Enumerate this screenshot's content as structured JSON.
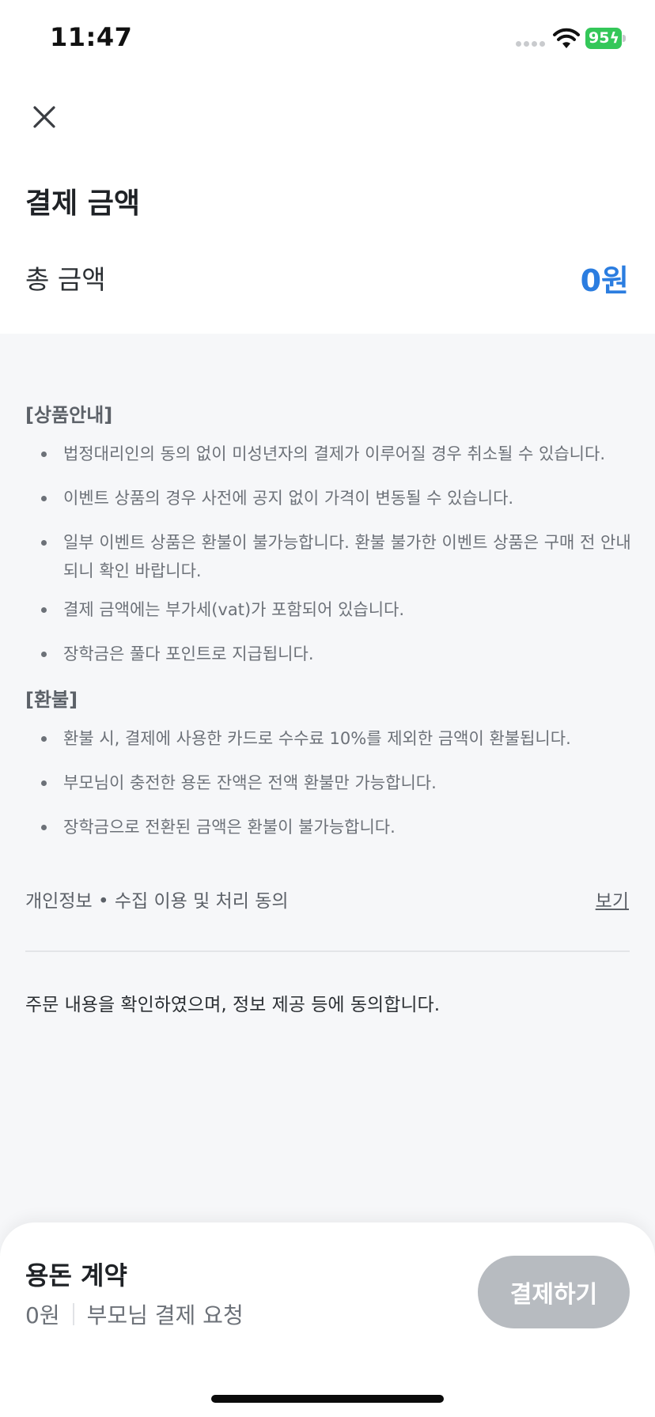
{
  "status_bar": {
    "time": "11:47",
    "battery": "95",
    "battery_color": "#34c759"
  },
  "header": {
    "close_icon": "close-icon"
  },
  "payment": {
    "title": "결제 금액",
    "total_label": "총 금액",
    "total_value": "0원",
    "accent": "#2b7de0"
  },
  "notice": {
    "product_heading": "[상품안내]",
    "product_items": [
      "법정대리인의 동의 없이 미성년자의 결제가 이루어질 경우 취소될 수 있습니다.",
      "이벤트 상품의 경우 사전에 공지 없이 가격이 변동될 수 있습니다.",
      "일부 이벤트 상품은 환불이 불가능합니다. 환불 불가한 이벤트 상품은 구매 전 안내되니 확인 바랍니다.",
      "결제 금액에는 부가세(vat)가 포함되어 있습니다.",
      "장학금은 풀다 포인트로 지급됩니다."
    ],
    "refund_heading": "[환불]",
    "refund_items": [
      "환불 시, 결제에 사용한 카드로 수수료 10%를 제외한 금액이 환불됩니다.",
      "부모님이 충전한 용돈 잔액은 전액 환불만 가능합니다.",
      "장학금으로 전환된 금액은 환불이 불가능합니다."
    ]
  },
  "privacy": {
    "label": "개인정보 • 수집 이용 및 처리 동의",
    "link": "보기"
  },
  "consent_text": "주문 내용을 확인하였으며, 정보 제공 등에 동의합니다.",
  "bottom_bar": {
    "plan_name": "용돈 계약",
    "price": "0원",
    "subtitle": "부모님 결제 요청",
    "pay_button": "결제하기",
    "button_color": "#b7bbc0"
  }
}
